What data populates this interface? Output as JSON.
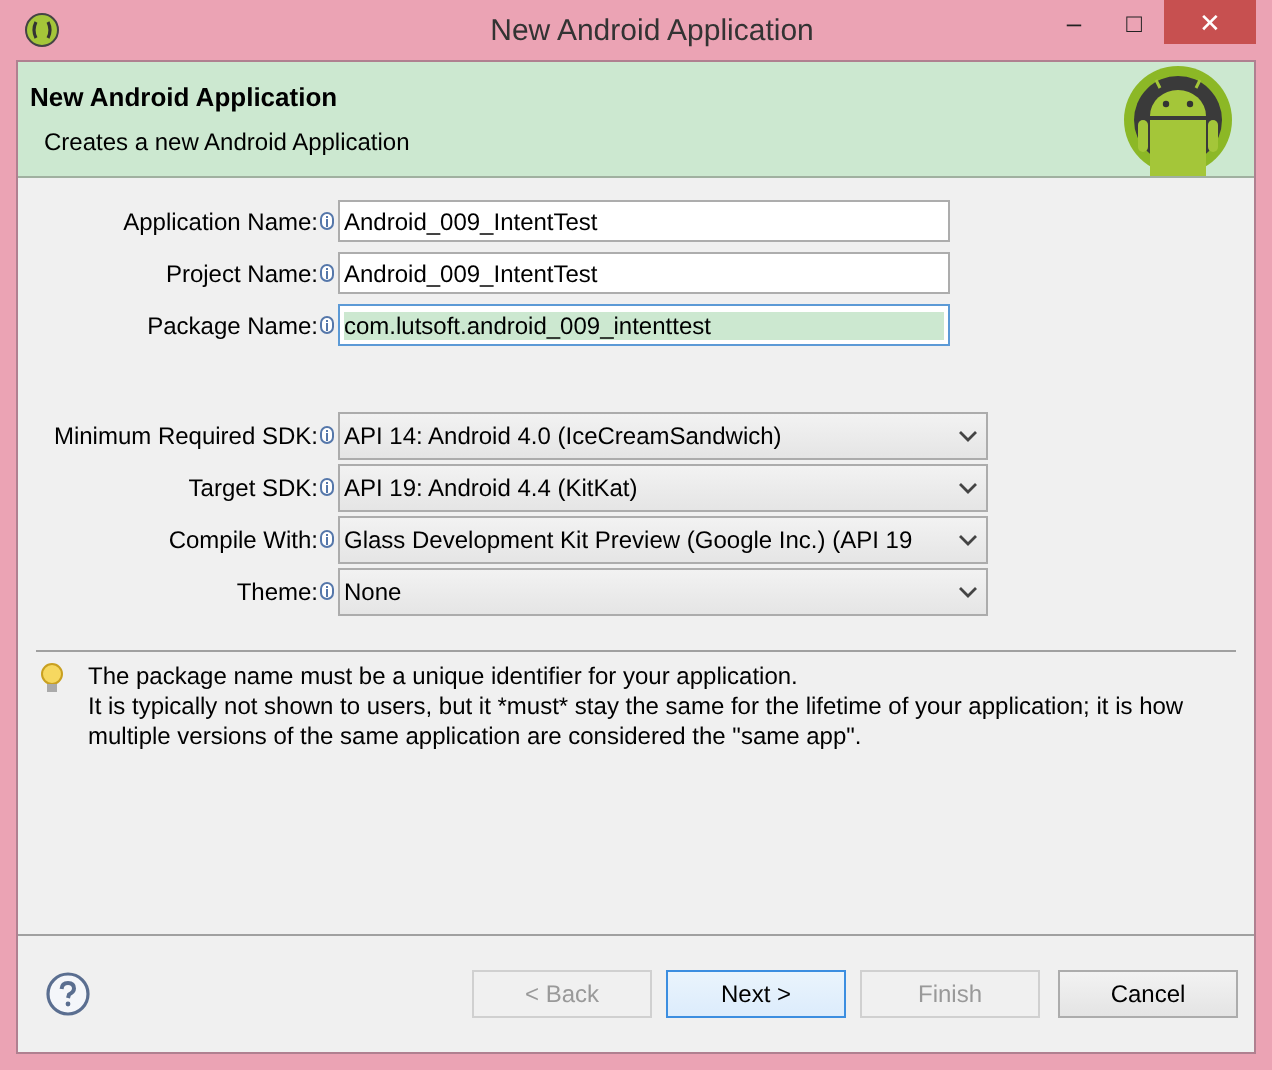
{
  "window": {
    "title": "New Android Application",
    "controls": [
      "–",
      "□",
      "✕"
    ]
  },
  "header": {
    "title": "New Android Application",
    "subtitle": "Creates a new Android Application"
  },
  "fields": [
    {
      "kind": "text",
      "label": "Application Name:",
      "value": "Android_009_IntentTest",
      "focused": false
    },
    {
      "kind": "text",
      "label": "Project Name:",
      "value": "Android_009_IntentTest",
      "focused": false
    },
    {
      "kind": "text",
      "label": "Package Name:",
      "value": "com.lutsoft.android_009_intenttest",
      "focused": true
    },
    {
      "kind": "gap"
    },
    {
      "kind": "combo",
      "label": "Minimum Required SDK:",
      "value": "API 14: Android 4.0 (IceCreamSandwich)"
    },
    {
      "kind": "combo",
      "label": "Target SDK:",
      "value": "API 19: Android 4.4 (KitKat)"
    },
    {
      "kind": "combo",
      "label": "Compile With:",
      "value": "Glass Development Kit Preview (Google Inc.) (API 19"
    },
    {
      "kind": "combo",
      "label": "Theme:",
      "value": "None"
    }
  ],
  "info": {
    "lines": [
      "The package name must be a unique identifier for your application.",
      "It is typically not shown to users, but it *must* stay the same for the lifetime of your application; it is how multiple versions of the same application are considered the \"same app\"."
    ]
  },
  "buttons": [
    {
      "label": "< Back",
      "disabled": true,
      "default": false
    },
    {
      "label": "Next >",
      "disabled": false,
      "default": true
    },
    {
      "label": "Finish",
      "disabled": true,
      "default": false
    },
    {
      "label": "Cancel",
      "disabled": false,
      "default": false
    }
  ]
}
